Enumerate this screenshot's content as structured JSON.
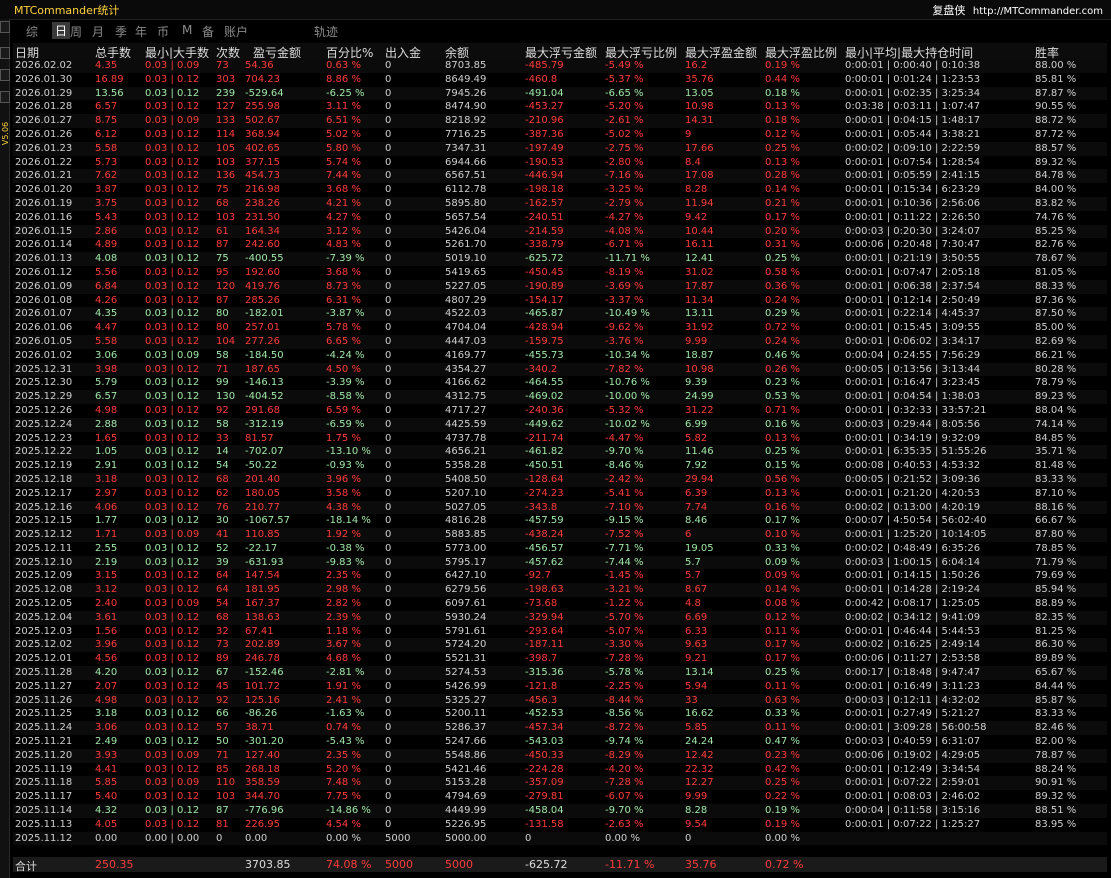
{
  "window": {
    "title": "MTCommander统计",
    "brand": "复盘侠",
    "brand_url": "http://MTCommander.com",
    "version": "V5.06"
  },
  "tabs": [
    "综",
    "日",
    "周",
    "月",
    "季",
    "年",
    "币",
    "M",
    "备",
    "账户",
    "轨迹"
  ],
  "active_tab": "日",
  "columns": [
    "日期",
    "总手数",
    "最小|大手数",
    "次数",
    "盈亏金额",
    "百分比%",
    "出入金",
    "余额",
    "最大浮亏金额",
    "最大浮亏比例",
    "最大浮盈金额",
    "最大浮盈比例",
    "最小|平均|最大持仓时间",
    "胜率"
  ],
  "rows": [
    [
      "2026.02.02",
      "4.35",
      "0.03 | 0.09",
      "73",
      "54.36",
      "0.63 %",
      "0",
      "8703.85",
      "-485.79",
      "-5.49 %",
      "16.2",
      "0.19 %",
      "0:00:01 | 0:00:40 | 0:10:38",
      "88.00 %",
      "r"
    ],
    [
      "2026.01.30",
      "16.89",
      "0.03 | 0.12",
      "303",
      "704.23",
      "8.86 %",
      "0",
      "8649.49",
      "-460.8",
      "-5.37 %",
      "35.76",
      "0.44 %",
      "0:00:01 | 0:01:24 | 1:23:53",
      "85.81 %",
      "r"
    ],
    [
      "2026.01.29",
      "13.56",
      "0.03 | 0.12",
      "239",
      "-529.64",
      "-6.25 %",
      "0",
      "7945.26",
      "-491.04",
      "-6.65 %",
      "13.05",
      "0.18 %",
      "0:00:01 | 0:02:35 | 3:25:34",
      "87.87 %",
      "g"
    ],
    [
      "2026.01.28",
      "6.57",
      "0.03 | 0.12",
      "127",
      "255.98",
      "3.11 %",
      "0",
      "8474.90",
      "-453.27",
      "-5.20 %",
      "10.98",
      "0.13 %",
      "0:03:38 | 0:03:11 | 1:07:47",
      "90.55 %",
      "r"
    ],
    [
      "2026.01.27",
      "8.75",
      "0.03 | 0.09",
      "133",
      "502.67",
      "6.51 %",
      "0",
      "8218.92",
      "-210.96",
      "-2.61 %",
      "14.31",
      "0.18 %",
      "0:00:01 | 0:04:15 | 1:48:17",
      "88.72 %",
      "r"
    ],
    [
      "2026.01.26",
      "6.12",
      "0.03 | 0.12",
      "114",
      "368.94",
      "5.02 %",
      "0",
      "7716.25",
      "-387.36",
      "-5.02 %",
      "9",
      "0.12 %",
      "0:00:01 | 0:05:44 | 3:38:21",
      "87.72 %",
      "r"
    ],
    [
      "2026.01.23",
      "5.58",
      "0.03 | 0.12",
      "105",
      "402.65",
      "5.80 %",
      "0",
      "7347.31",
      "-197.49",
      "-2.75 %",
      "17.66",
      "0.25 %",
      "0:00:02 | 0:09:10 | 2:22:59",
      "88.57 %",
      "r"
    ],
    [
      "2026.01.22",
      "5.73",
      "0.03 | 0.12",
      "103",
      "377.15",
      "5.74 %",
      "0",
      "6944.66",
      "-190.53",
      "-2.80 %",
      "8.4",
      "0.13 %",
      "0:00:01 | 0:07:54 | 1:28:54",
      "89.32 %",
      "r"
    ],
    [
      "2026.01.21",
      "7.62",
      "0.03 | 0.12",
      "136",
      "454.73",
      "7.44 %",
      "0",
      "6567.51",
      "-446.94",
      "-7.16 %",
      "17.08",
      "0.28 %",
      "0:00:01 | 0:05:59 | 2:41:15",
      "84.78 %",
      "r"
    ],
    [
      "2026.01.20",
      "3.87",
      "0.03 | 0.12",
      "75",
      "216.98",
      "3.68 %",
      "0",
      "6112.78",
      "-198.18",
      "-3.25 %",
      "8.28",
      "0.14 %",
      "0:00:01 | 0:15:34 | 6:23:29",
      "84.00 %",
      "r"
    ],
    [
      "2026.01.19",
      "3.75",
      "0.03 | 0.12",
      "68",
      "238.26",
      "4.21 %",
      "0",
      "5895.80",
      "-162.57",
      "-2.79 %",
      "11.94",
      "0.21 %",
      "0:00:01 | 0:10:36 | 2:56:06",
      "83.82 %",
      "r"
    ],
    [
      "2026.01.16",
      "5.43",
      "0.03 | 0.12",
      "103",
      "231.50",
      "4.27 %",
      "0",
      "5657.54",
      "-240.51",
      "-4.27 %",
      "9.42",
      "0.17 %",
      "0:00:01 | 0:11:22 | 2:26:50",
      "74.76 %",
      "r"
    ],
    [
      "2026.01.15",
      "2.86",
      "0.03 | 0.12",
      "61",
      "164.34",
      "3.12 %",
      "0",
      "5426.04",
      "-214.59",
      "-4.08 %",
      "10.44",
      "0.20 %",
      "0:00:03 | 0:20:30 | 3:24:07",
      "85.25 %",
      "r"
    ],
    [
      "2026.01.14",
      "4.89",
      "0.03 | 0.12",
      "87",
      "242.60",
      "4.83 %",
      "0",
      "5261.70",
      "-338.79",
      "-6.71 %",
      "16.11",
      "0.31 %",
      "0:00:06 | 0:20:48 | 7:30:47",
      "82.76 %",
      "r"
    ],
    [
      "2026.01.13",
      "4.08",
      "0.03 | 0.12",
      "75",
      "-400.55",
      "-7.39 %",
      "0",
      "5019.10",
      "-625.72",
      "-11.71 %",
      "12.41",
      "0.25 %",
      "0:00:01 | 0:21:19 | 3:50:55",
      "78.67 %",
      "g"
    ],
    [
      "2026.01.12",
      "5.56",
      "0.03 | 0.12",
      "95",
      "192.60",
      "3.68 %",
      "0",
      "5419.65",
      "-450.45",
      "-8.19 %",
      "31.02",
      "0.58 %",
      "0:00:01 | 0:07:47 | 2:05:18",
      "81.05 %",
      "r"
    ],
    [
      "2026.01.09",
      "6.84",
      "0.03 | 0.12",
      "120",
      "419.76",
      "8.73 %",
      "0",
      "5227.05",
      "-190.89",
      "-3.69 %",
      "17.87",
      "0.36 %",
      "0:00:01 | 0:06:38 | 2:37:54",
      "88.33 %",
      "r"
    ],
    [
      "2026.01.08",
      "4.26",
      "0.03 | 0.12",
      "87",
      "285.26",
      "6.31 %",
      "0",
      "4807.29",
      "-154.17",
      "-3.37 %",
      "11.34",
      "0.24 %",
      "0:00:01 | 0:12:14 | 2:50:49",
      "87.36 %",
      "r"
    ],
    [
      "2026.01.07",
      "4.35",
      "0.03 | 0.12",
      "80",
      "-182.01",
      "-3.87 %",
      "0",
      "4522.03",
      "-465.87",
      "-10.49 %",
      "13.11",
      "0.29 %",
      "0:00:01 | 0:22:14 | 4:45:37",
      "87.50 %",
      "g"
    ],
    [
      "2026.01.06",
      "4.47",
      "0.03 | 0.12",
      "80",
      "257.01",
      "5.78 %",
      "0",
      "4704.04",
      "-428.94",
      "-9.62 %",
      "31.92",
      "0.72 %",
      "0:00:01 | 0:15:45 | 3:09:55",
      "85.00 %",
      "r"
    ],
    [
      "2026.01.05",
      "5.58",
      "0.03 | 0.12",
      "104",
      "277.26",
      "6.65 %",
      "0",
      "4447.03",
      "-159.75",
      "-3.76 %",
      "9.99",
      "0.24 %",
      "0:00:01 | 0:06:02 | 3:34:17",
      "82.69 %",
      "r"
    ],
    [
      "2026.01.02",
      "3.06",
      "0.03 | 0.09",
      "58",
      "-184.50",
      "-4.24 %",
      "0",
      "4169.77",
      "-455.73",
      "-10.34 %",
      "18.87",
      "0.46 %",
      "0:00:04 | 0:24:55 | 7:56:29",
      "86.21 %",
      "g"
    ],
    [
      "2025.12.31",
      "3.98",
      "0.03 | 0.12",
      "71",
      "187.65",
      "4.50 %",
      "0",
      "4354.27",
      "-340.2",
      "-7.82 %",
      "10.98",
      "0.26 %",
      "0:00:05 | 0:13:56 | 3:13:44",
      "80.28 %",
      "r"
    ],
    [
      "2025.12.30",
      "5.79",
      "0.03 | 0.12",
      "99",
      "-146.13",
      "-3.39 %",
      "0",
      "4166.62",
      "-464.55",
      "-10.76 %",
      "9.39",
      "0.23 %",
      "0:00:01 | 0:16:47 | 3:23:45",
      "78.79 %",
      "g"
    ],
    [
      "2025.12.29",
      "6.57",
      "0.03 | 0.12",
      "130",
      "-404.52",
      "-8.58 %",
      "0",
      "4312.75",
      "-469.02",
      "-10.00 %",
      "24.99",
      "0.53 %",
      "0:00:01 | 0:04:54 | 1:38:03",
      "89.23 %",
      "g"
    ],
    [
      "2025.12.26",
      "4.98",
      "0.03 | 0.12",
      "92",
      "291.68",
      "6.59 %",
      "0",
      "4717.27",
      "-240.36",
      "-5.32 %",
      "31.22",
      "0.71 %",
      "0:00:01 | 0:32:33 | 33:57:21",
      "88.04 %",
      "r"
    ],
    [
      "2025.12.24",
      "2.88",
      "0.03 | 0.12",
      "58",
      "-312.19",
      "-6.59 %",
      "0",
      "4425.59",
      "-449.62",
      "-10.02 %",
      "6.99",
      "0.16 %",
      "0:00:03 | 0:29:44 | 8:05:56",
      "74.14 %",
      "g"
    ],
    [
      "2025.12.23",
      "1.65",
      "0.03 | 0.12",
      "33",
      "81.57",
      "1.75 %",
      "0",
      "4737.78",
      "-211.74",
      "-4.47 %",
      "5.82",
      "0.13 %",
      "0:00:01 | 0:34:19 | 9:32:09",
      "84.85 %",
      "r"
    ],
    [
      "2025.12.22",
      "1.05",
      "0.03 | 0.12",
      "14",
      "-702.07",
      "-13.10 %",
      "0",
      "4656.21",
      "-461.82",
      "-9.70 %",
      "11.46",
      "0.25 %",
      "0:00:01 | 6:35:35 | 51:55:26",
      "35.71 %",
      "g"
    ],
    [
      "2025.12.19",
      "2.91",
      "0.03 | 0.12",
      "54",
      "-50.22",
      "-0.93 %",
      "0",
      "5358.28",
      "-450.51",
      "-8.46 %",
      "7.92",
      "0.15 %",
      "0:00:08 | 0:40:53 | 4:53:32",
      "81.48 %",
      "g"
    ],
    [
      "2025.12.18",
      "3.18",
      "0.03 | 0.12",
      "68",
      "201.40",
      "3.96 %",
      "0",
      "5408.50",
      "-128.64",
      "-2.42 %",
      "29.94",
      "0.56 %",
      "0:00:05 | 0:21:52 | 3:09:36",
      "83.33 %",
      "r"
    ],
    [
      "2025.12.17",
      "2.97",
      "0.03 | 0.12",
      "62",
      "180.05",
      "3.58 %",
      "0",
      "5207.10",
      "-274.23",
      "-5.41 %",
      "6.39",
      "0.13 %",
      "0:00:01 | 0:21:20 | 4:20:53",
      "87.10 %",
      "r"
    ],
    [
      "2025.12.16",
      "4.06",
      "0.03 | 0.12",
      "76",
      "210.77",
      "4.38 %",
      "0",
      "5027.05",
      "-343.8",
      "-7.10 %",
      "7.74",
      "0.16 %",
      "0:00:02 | 0:13:00 | 4:20:19",
      "88.16 %",
      "r"
    ],
    [
      "2025.12.15",
      "1.77",
      "0.03 | 0.12",
      "30",
      "-1067.57",
      "-18.14 %",
      "0",
      "4816.28",
      "-457.59",
      "-9.15 %",
      "8.46",
      "0.17 %",
      "0:00:07 | 4:50:54 | 56:02:40",
      "66.67 %",
      "g"
    ],
    [
      "2025.12.12",
      "1.71",
      "0.03 | 0.09",
      "41",
      "110.85",
      "1.92 %",
      "0",
      "5883.85",
      "-438.24",
      "-7.52 %",
      "6",
      "0.10 %",
      "0:00:01 | 1:25:20 | 10:14:05",
      "87.80 %",
      "r"
    ],
    [
      "2025.12.11",
      "2.55",
      "0.03 | 0.12",
      "52",
      "-22.17",
      "-0.38 %",
      "0",
      "5773.00",
      "-456.57",
      "-7.71 %",
      "19.05",
      "0.33 %",
      "0:00:02 | 0:48:49 | 6:35:26",
      "78.85 %",
      "g"
    ],
    [
      "2025.12.10",
      "2.19",
      "0.03 | 0.12",
      "39",
      "-631.93",
      "-9.83 %",
      "0",
      "5795.17",
      "-457.62",
      "-7.44 %",
      "5.7",
      "0.09 %",
      "0:00:03 | 1:00:15 | 6:04:14",
      "71.79 %",
      "g"
    ],
    [
      "2025.12.09",
      "3.15",
      "0.03 | 0.12",
      "64",
      "147.54",
      "2.35 %",
      "0",
      "6427.10",
      "-92.7",
      "-1.45 %",
      "5.7",
      "0.09 %",
      "0:00:01 | 0:14:15 | 1:50:26",
      "79.69 %",
      "r"
    ],
    [
      "2025.12.08",
      "3.12",
      "0.03 | 0.12",
      "64",
      "181.95",
      "2.98 %",
      "0",
      "6279.56",
      "-198.63",
      "-3.21 %",
      "8.67",
      "0.14 %",
      "0:00:01 | 0:14:28 | 2:19:24",
      "85.94 %",
      "r"
    ],
    [
      "2025.12.05",
      "2.40",
      "0.03 | 0.09",
      "54",
      "167.37",
      "2.82 %",
      "0",
      "6097.61",
      "-73.68",
      "-1.22 %",
      "4.8",
      "0.08 %",
      "0:00:42 | 0:08:17 | 1:25:05",
      "88.89 %",
      "r"
    ],
    [
      "2025.12.04",
      "3.61",
      "0.03 | 0.12",
      "68",
      "138.63",
      "2.39 %",
      "0",
      "5930.24",
      "-329.94",
      "-5.70 %",
      "6.69",
      "0.12 %",
      "0:00:02 | 0:34:12 | 9:41:09",
      "82.35 %",
      "r"
    ],
    [
      "2025.12.03",
      "1.56",
      "0.03 | 0.12",
      "32",
      "67.41",
      "1.18 %",
      "0",
      "5791.61",
      "-293.64",
      "-5.07 %",
      "6.33",
      "0.11 %",
      "0:00:01 | 0:46:44 | 5:44:53",
      "81.25 %",
      "r"
    ],
    [
      "2025.12.02",
      "3.96",
      "0.03 | 0.12",
      "73",
      "202.89",
      "3.67 %",
      "0",
      "5724.20",
      "-187.11",
      "-3.30 %",
      "9.63",
      "0.17 %",
      "0:00:02 | 0:16:25 | 2:49:14",
      "86.30 %",
      "r"
    ],
    [
      "2025.12.01",
      "4.56",
      "0.03 | 0.12",
      "89",
      "246.78",
      "4.68 %",
      "0",
      "5521.31",
      "-398.7",
      "-7.28 %",
      "9.21",
      "0.17 %",
      "0:00:06 | 0:11:27 | 2:53:58",
      "89.89 %",
      "r"
    ],
    [
      "2025.11.28",
      "4.20",
      "0.03 | 0.12",
      "67",
      "-152.46",
      "-2.81 %",
      "0",
      "5274.53",
      "-315.36",
      "-5.78 %",
      "13.14",
      "0.25 %",
      "0:00:17 | 0:18:48 | 9:47:47",
      "65.67 %",
      "g"
    ],
    [
      "2025.11.27",
      "2.07",
      "0.03 | 0.12",
      "45",
      "101.72",
      "1.91 %",
      "0",
      "5426.99",
      "-121.8",
      "-2.25 %",
      "5.94",
      "0.11 %",
      "0:00:01 | 0:16:49 | 3:11:23",
      "84.44 %",
      "r"
    ],
    [
      "2025.11.26",
      "4.98",
      "0.03 | 0.12",
      "92",
      "125.16",
      "2.41 %",
      "0",
      "5325.27",
      "-456.3",
      "-8.44 %",
      "33",
      "0.63 %",
      "0:00:03 | 0:12:11 | 4:32:02",
      "85.87 %",
      "r"
    ],
    [
      "2025.11.25",
      "3.18",
      "0.03 | 0.12",
      "66",
      "-86.26",
      "-1.63 %",
      "0",
      "5200.11",
      "-452.53",
      "-8.56 %",
      "16.62",
      "0.33 %",
      "0:00:01 | 0:27:49 | 5:21:27",
      "83.33 %",
      "g"
    ],
    [
      "2025.11.24",
      "3.06",
      "0.03 | 0.12",
      "57",
      "38.71",
      "0.74 %",
      "0",
      "5286.37",
      "-457.34",
      "-8.72 %",
      "5.85",
      "0.11 %",
      "0:00:01 | 3:09:28 | 56:00:58",
      "82.46 %",
      "r"
    ],
    [
      "2025.11.21",
      "2.49",
      "0.03 | 0.12",
      "50",
      "-301.20",
      "-5.43 %",
      "0",
      "5247.66",
      "-543.03",
      "-9.74 %",
      "24.24",
      "0.47 %",
      "0:00:03 | 0:40:59 | 6:31:07",
      "82.00 %",
      "g"
    ],
    [
      "2025.11.20",
      "3.93",
      "0.03 | 0.09",
      "71",
      "127.40",
      "2.35 %",
      "0",
      "5548.86",
      "-450.33",
      "-8.29 %",
      "12.42",
      "0.23 %",
      "0:00:06 | 0:19:02 | 4:29:05",
      "78.87 %",
      "r"
    ],
    [
      "2025.11.19",
      "4.41",
      "0.03 | 0.12",
      "85",
      "268.18",
      "5.20 %",
      "0",
      "5421.46",
      "-224.28",
      "-4.20 %",
      "22.32",
      "0.42 %",
      "0:00:01 | 0:12:49 | 3:34:54",
      "88.24 %",
      "r"
    ],
    [
      "2025.11.18",
      "5.85",
      "0.03 | 0.09",
      "110",
      "358.59",
      "7.48 %",
      "0",
      "5153.28",
      "-357.09",
      "-7.28 %",
      "12.27",
      "0.25 %",
      "0:00:01 | 0:07:22 | 2:59:01",
      "90.91 %",
      "r"
    ],
    [
      "2025.11.17",
      "5.40",
      "0.03 | 0.12",
      "103",
      "344.70",
      "7.75 %",
      "0",
      "4794.69",
      "-279.81",
      "-6.07 %",
      "9.99",
      "0.22 %",
      "0:00:01 | 0:08:03 | 2:46:02",
      "89.32 %",
      "r"
    ],
    [
      "2025.11.14",
      "4.32",
      "0.03 | 0.12",
      "87",
      "-776.96",
      "-14.86 %",
      "0",
      "4449.99",
      "-458.04",
      "-9.70 %",
      "8.28",
      "0.19 %",
      "0:00:04 | 0:11:58 | 3:15:16",
      "88.51 %",
      "g"
    ],
    [
      "2025.11.13",
      "4.05",
      "0.03 | 0.12",
      "81",
      "226.95",
      "4.54 %",
      "0",
      "5226.95",
      "-131.58",
      "-2.63 %",
      "9.54",
      "0.19 %",
      "0:00:01 | 0:07:22 | 1:25:27",
      "83.95 %",
      "r"
    ],
    [
      "2025.11.12",
      "0.00",
      "0.00 | 0.00",
      "0",
      "0.00",
      "0.00 %",
      "5000",
      "5000.00",
      "0",
      "0.00 %",
      "0",
      "0.00 %",
      "",
      "",
      "w"
    ]
  ],
  "totals": {
    "label": "合计",
    "lots": "250.35",
    "pnl": "3703.85",
    "pct": "74.08 %",
    "deposit": "5000",
    "max_loss": "-625.72",
    "max_loss_pct": "-11.71 %",
    "max_profit": "35.76",
    "max_profit_pct": "0.72 %"
  },
  "colors": {
    "negative": "#9fe6a6",
    "positive": "#ff3b3b",
    "neutral": "#cfcfcf",
    "title": "#ffd23a"
  }
}
